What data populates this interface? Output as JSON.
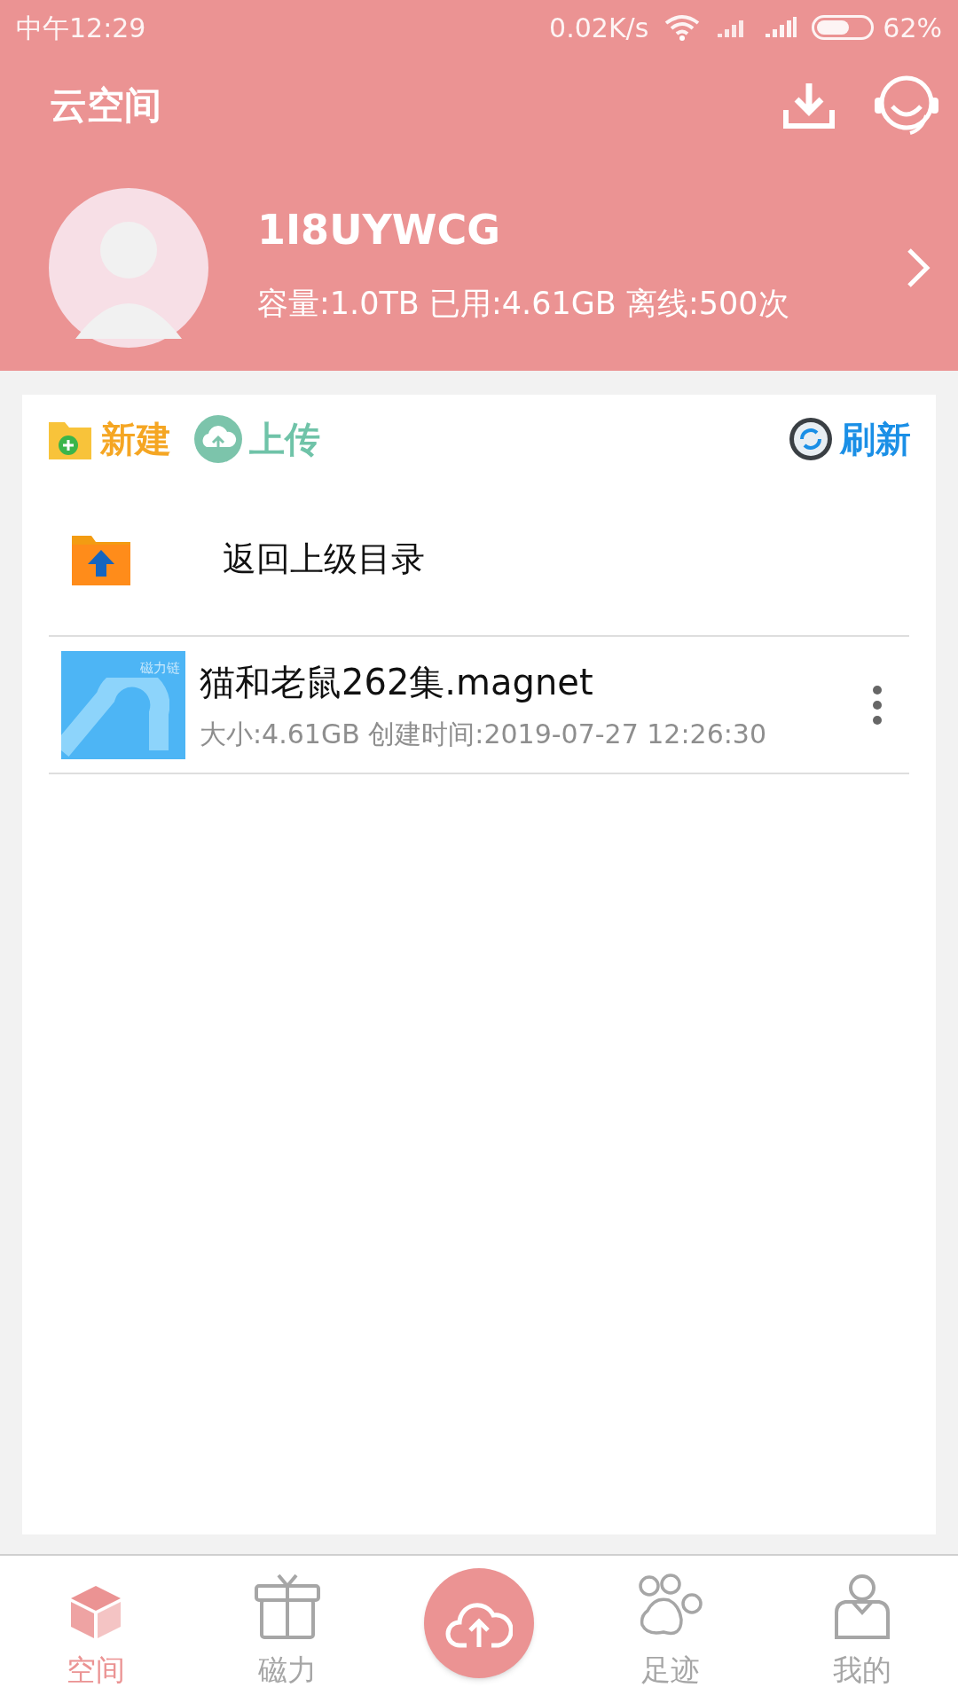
{
  "status_bar": {
    "time": "中午12:29",
    "speed": "0.02K/s",
    "battery_percent": "62%"
  },
  "header": {
    "title": "云空间"
  },
  "profile": {
    "username": "1I8UYWCG",
    "info": "容量:1.0TB 已用:4.61GB 离线:500次"
  },
  "toolbar": [
    {
      "kind": "new",
      "label": "新建",
      "color": "#f5a623"
    },
    {
      "kind": "upload",
      "label": "上传",
      "color": "#6fc3a8"
    },
    {
      "kind": "refresh",
      "label": "刷新",
      "color": "#1a8fe6"
    }
  ],
  "files": [
    {
      "kind": "parent",
      "name": "返回上级目录"
    },
    {
      "kind": "magnet",
      "name": "猫和老鼠262集.magnet",
      "thumb_label": "磁力链",
      "meta": "大小:4.61GB 创建时间:2019-07-27 12:26:30"
    }
  ],
  "nav": [
    {
      "kind": "box",
      "label": "空间",
      "selected": true
    },
    {
      "kind": "gift",
      "label": "磁力",
      "selected": false
    },
    {
      "kind": "center"
    },
    {
      "kind": "paw",
      "label": "足迹",
      "selected": false
    },
    {
      "kind": "person",
      "label": "我的",
      "selected": false
    }
  ]
}
